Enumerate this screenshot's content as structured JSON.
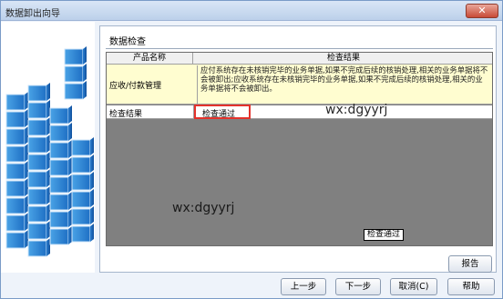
{
  "window": {
    "title": "数据卸出向导",
    "close_glyph": "✕"
  },
  "section": {
    "title": "数据检查"
  },
  "grid": {
    "columns": [
      "产品名称",
      "检查结果"
    ],
    "rows": [
      {
        "product": "应收/付款管理",
        "result": "应付系统存在未核销完毕的业务单据,如果不完成后续的核销处理,相关的业务单据将不会被卸出;应收系统存在未核销完毕的业务单据,如果不完成后续的核销处理,相关的业务单据将不会被卸出。"
      },
      {
        "product": "检查结果",
        "result": "检查通过"
      }
    ],
    "tooltip": "检查通过"
  },
  "watermarks": [
    "wx:dgyyrj",
    "wx:dgyyrj"
  ],
  "buttons": {
    "report": "报告",
    "prev": "上一步",
    "next": "下一步",
    "cancel": "取消(C)",
    "help": "帮助"
  },
  "colors": {
    "highlight_border": "#e4322b",
    "warning_row": "#fffdd0",
    "grid_empty": "#808080"
  }
}
